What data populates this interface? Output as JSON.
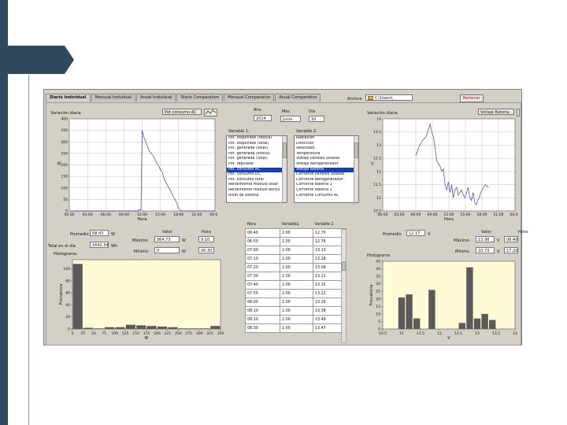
{
  "tabs": [
    {
      "label": "Diario Individual",
      "active": true
    },
    {
      "label": "Mensual Individual",
      "active": false
    },
    {
      "label": "Anual Individual",
      "active": false
    },
    {
      "label": "Diario Comparativo",
      "active": false
    },
    {
      "label": "Mensual Comparativo",
      "active": false
    },
    {
      "label": "Anual Comparativo",
      "active": false
    }
  ],
  "archivo": {
    "label": "Archivo",
    "value": "C:\\Users\\"
  },
  "reiniciar": "Reiniciar",
  "date": {
    "year_label": "Año",
    "year": "2014",
    "month_label": "Mes",
    "month": "Junio",
    "day_label": "Día",
    "day": "10"
  },
  "var1": {
    "label": "Variable 1:",
    "items": [
      "Pot. disponible (radica)",
      "Pot. disponible (total)",
      "Pot. generada (solar)",
      "Pot. generada (eólica)",
      "Pot. generada (total)",
      "Pot. regulada",
      "Pot. consumo AC",
      "Pot. consumo DC",
      "Pot. consumo total",
      "Rendimiento modulo solar",
      "Rendimiento modulo eólico",
      "Nivel de bateria"
    ],
    "selected": 6
  },
  "var2": {
    "label": "Variable 2:",
    "items": [
      "Radiación",
      "Dirección",
      "Velocidad",
      "Temperatura",
      "Voltaje Paneles Solares",
      "Voltaje Aerogenerador",
      "Voltaje Bateria",
      "Corriente Paneles Solares",
      "Corriente Aerogenerador",
      "Corriente Bateria 1",
      "Corriente Bateria 2",
      "Corriente Consumo AC"
    ],
    "selected": 6
  },
  "left": {
    "title": "Variación diaria",
    "selector": "Pot consumo AC",
    "ylabel": "W",
    "xlabel": "Hora",
    "promedio_label": "Promedio",
    "promedio": "58.43",
    "promedio_unit": "W",
    "total_label": "Total en el día",
    "total": "1642.34",
    "total_unit": "Wh",
    "valor_hdr": "Valor",
    "hora_hdr": "Hora",
    "maximo_label": "Máximo",
    "maximo": "364.73",
    "maximo_unit": "W",
    "maximo_hora": "9:10",
    "minimo_label": "Mínimo",
    "minimo": "0",
    "minimo_unit": "W",
    "minimo_hora": "00:30",
    "hist_title": "Histograma",
    "hist_ylabel": "Frecuencia",
    "hist_xlabel": "W"
  },
  "right": {
    "title": "Variación diaria",
    "selector": "Voltaje Bateria",
    "ylabel": "V",
    "xlabel": "Hora",
    "promedio_label": "Promedio",
    "promedio": "12.17",
    "promedio_unit": "V",
    "valor_hdr": "Valor",
    "hora_hdr": "Hora",
    "maximo_label": "Máximo",
    "maximo": "13.98",
    "maximo_unit": "V",
    "maximo_hora": "08:40",
    "minimo_label": "Mínimo",
    "minimo": "10.73",
    "minimo_unit": "V",
    "minimo_hora": "17:20",
    "hist_title": "Histograma",
    "hist_ylabel": "Frecuencia",
    "hist_xlabel": "V"
  },
  "table": {
    "headers": [
      "Hora",
      "Variable1",
      "Variable 2"
    ],
    "rows": [
      [
        "06:40",
        "2.00",
        "12.70"
      ],
      [
        "06:50",
        "2.00",
        "12.76"
      ],
      [
        "07:00",
        "2.00",
        "13.13"
      ],
      [
        "07:10",
        "2.00",
        "13.28"
      ],
      [
        "07:20",
        "2.00",
        "13.04"
      ],
      [
        "07:30",
        "2.00",
        "13.11"
      ],
      [
        "07:40",
        "2.00",
        "13.15"
      ],
      [
        "07:50",
        "2.00",
        "13.22"
      ],
      [
        "08:00",
        "2.00",
        "13.26"
      ],
      [
        "08:10",
        "2.00",
        "13.38"
      ],
      [
        "08:20",
        "2.00",
        "13.49"
      ],
      [
        "08:30",
        "2.00",
        "13.47"
      ]
    ]
  },
  "chart_data": [
    {
      "type": "line",
      "name": "left-daily",
      "x_ticks": [
        "00:00",
        "03:00",
        "06:00",
        "09:00",
        "12:00",
        "15:00",
        "18:00",
        "21:00",
        "00:00"
      ],
      "y_ticks": [
        0,
        50,
        100,
        150,
        200,
        250,
        300,
        350,
        400
      ],
      "xlim": [
        0,
        24
      ],
      "ylim": [
        0,
        400
      ],
      "grid": true,
      "x": [
        0,
        1,
        2,
        3,
        4,
        5,
        6,
        7,
        8,
        9,
        9.3,
        9.5,
        9.8,
        10,
        10.5,
        11,
        11.3,
        11.5,
        11.8,
        12,
        12.3,
        12.6,
        12.9,
        13.2,
        13.5,
        13.8,
        14.1,
        14.4,
        14.7,
        15,
        15.3,
        15.6,
        15.9,
        16.2,
        16.5,
        16.8,
        17.1,
        17.4,
        17.7,
        18,
        18.5,
        19,
        20,
        21,
        22,
        23,
        24
      ],
      "y": [
        0,
        0,
        0,
        0,
        0,
        0,
        0,
        0,
        0,
        0,
        0,
        0,
        0,
        0,
        0,
        0,
        0,
        5,
        5,
        350,
        320,
        300,
        280,
        260,
        250,
        240,
        225,
        210,
        195,
        180,
        170,
        140,
        125,
        110,
        95,
        80,
        65,
        50,
        35,
        10,
        0,
        0,
        0,
        0,
        0,
        0,
        0
      ]
    },
    {
      "type": "line",
      "name": "right-daily",
      "x_ticks": [
        "00:00",
        "03:00",
        "06:00",
        "09:00",
        "12:00",
        "15:00",
        "18:00",
        "21:00",
        "00:00"
      ],
      "y_ticks": [
        10.5,
        11,
        11.5,
        12,
        12.5,
        13,
        13.5,
        14
      ],
      "xlim": [
        0,
        24
      ],
      "ylim": [
        10.5,
        14
      ],
      "grid": true,
      "x": [
        0,
        5,
        6,
        6.5,
        7,
        7.3,
        7.6,
        8,
        8.3,
        8.6,
        8.9,
        9.2,
        9.5,
        9.8,
        10.1,
        10.4,
        10.7,
        11,
        11.3,
        11.6,
        11.9,
        12.2,
        12.5,
        12.8,
        13.1,
        13.4,
        13.7,
        14,
        14.3,
        14.6,
        14.9,
        15.2,
        15.5,
        15.8,
        16.1,
        16.4,
        16.7,
        17,
        17.2,
        17.5,
        17.8,
        18,
        18.3,
        18.6,
        18.9,
        19.2,
        24
      ],
      "y": [
        null,
        null,
        12.6,
        12.9,
        13.1,
        13.2,
        13.25,
        13.4,
        13.6,
        13.8,
        13.5,
        13.3,
        12.9,
        12.4,
        12.3,
        12.2,
        12.0,
        12.1,
        11.5,
        11.3,
        11.6,
        11.2,
        11.5,
        11.0,
        11.3,
        11.4,
        11.1,
        11.2,
        11.3,
        11.1,
        11.0,
        11.2,
        11.4,
        11.0,
        10.9,
        11.2,
        10.8,
        10.73,
        10.9,
        11.0,
        11.2,
        11.3,
        11.4,
        11.5,
        11.45,
        11.4,
        null
      ]
    },
    {
      "type": "bar",
      "name": "left-histogram",
      "x_ticks": [
        0,
        25,
        50,
        75,
        100,
        125,
        150,
        175,
        200,
        225,
        250,
        275,
        300,
        325,
        350
      ],
      "y_ticks": [
        0,
        20,
        40,
        60,
        80,
        100
      ],
      "bin_starts": [
        0,
        25,
        50,
        75,
        100,
        125,
        150,
        175,
        200,
        225,
        250,
        275,
        300,
        325
      ],
      "bin_width": 25,
      "values": [
        108,
        2,
        1,
        3,
        3,
        7,
        6,
        5,
        4,
        3,
        1,
        1,
        1,
        5
      ],
      "xlim": [
        0,
        350
      ],
      "ylim": [
        0,
        115
      ]
    },
    {
      "type": "bar",
      "name": "right-histogram",
      "x_ticks": [
        10.5,
        11,
        11.5,
        12,
        12.5,
        13,
        13.5,
        14
      ],
      "y_ticks": [
        0,
        5,
        10,
        15,
        20,
        25,
        30,
        35,
        40,
        45
      ],
      "bin_starts": [
        10.5,
        10.7,
        10.9,
        11.1,
        11.3,
        11.5,
        11.7,
        11.9,
        12.1,
        12.3,
        12.5,
        12.7,
        12.9,
        13.1,
        13.3,
        13.5,
        13.7
      ],
      "bin_width": 0.2,
      "values": [
        0,
        0,
        21,
        23,
        7,
        0,
        26,
        0,
        0,
        0,
        4,
        41,
        7,
        10,
        6,
        0,
        0
      ],
      "xlim": [
        10.5,
        14
      ],
      "ylim": [
        0,
        45
      ]
    }
  ],
  "colors": {
    "trace": "#4a3aa8",
    "plot_bg": "#ffffff",
    "hist_bg": "#fffbd6",
    "bar": "#5a5a5a",
    "slide": "#2f4a5f"
  }
}
